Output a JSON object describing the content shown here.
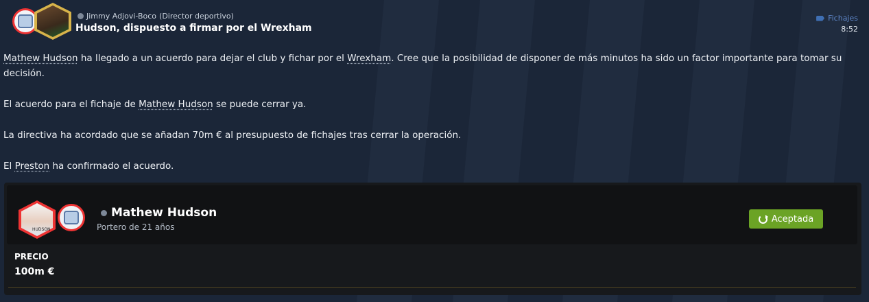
{
  "header": {
    "sender_name": "Jimmy Adjovi-Boco",
    "sender_role": "(Director deportivo)",
    "title": "Hudson, dispuesto a firmar por el Wrexham",
    "category": "Fichajes",
    "time": "8:52"
  },
  "message": {
    "p1": {
      "player": "Mathew Hudson",
      "a": " ha llegado a un acuerdo para dejar el club y fichar por el ",
      "club": "Wrexham",
      "b": ". Cree que la posibilidad de disponer de más minutos ha sido un factor importante para tomar su decisión."
    },
    "p2": {
      "a": "El acuerdo para el fichaje de ",
      "player": "Mathew Hudson",
      "b": " se puede cerrar ya."
    },
    "p3": "La directiva ha acordado que se añadan 70m € al presupuesto de fichajes tras cerrar la operación.",
    "p4": {
      "a": "El ",
      "club": "Preston",
      "b": " ha confirmado el acuerdo."
    }
  },
  "player_card": {
    "name": "Mathew Hudson",
    "description": "Portero de 21 años",
    "status_button": "Aceptada",
    "price_label": "PRECIO",
    "price_value": "100m €",
    "photo_caption": "HUDSON"
  },
  "colors": {
    "background": "#1b2638",
    "accent_green": "#6ba325",
    "category_blue": "#5e86c8",
    "club_red": "#e33333"
  },
  "icons": [
    "person-icon",
    "tag-icon",
    "refresh-icon"
  ]
}
